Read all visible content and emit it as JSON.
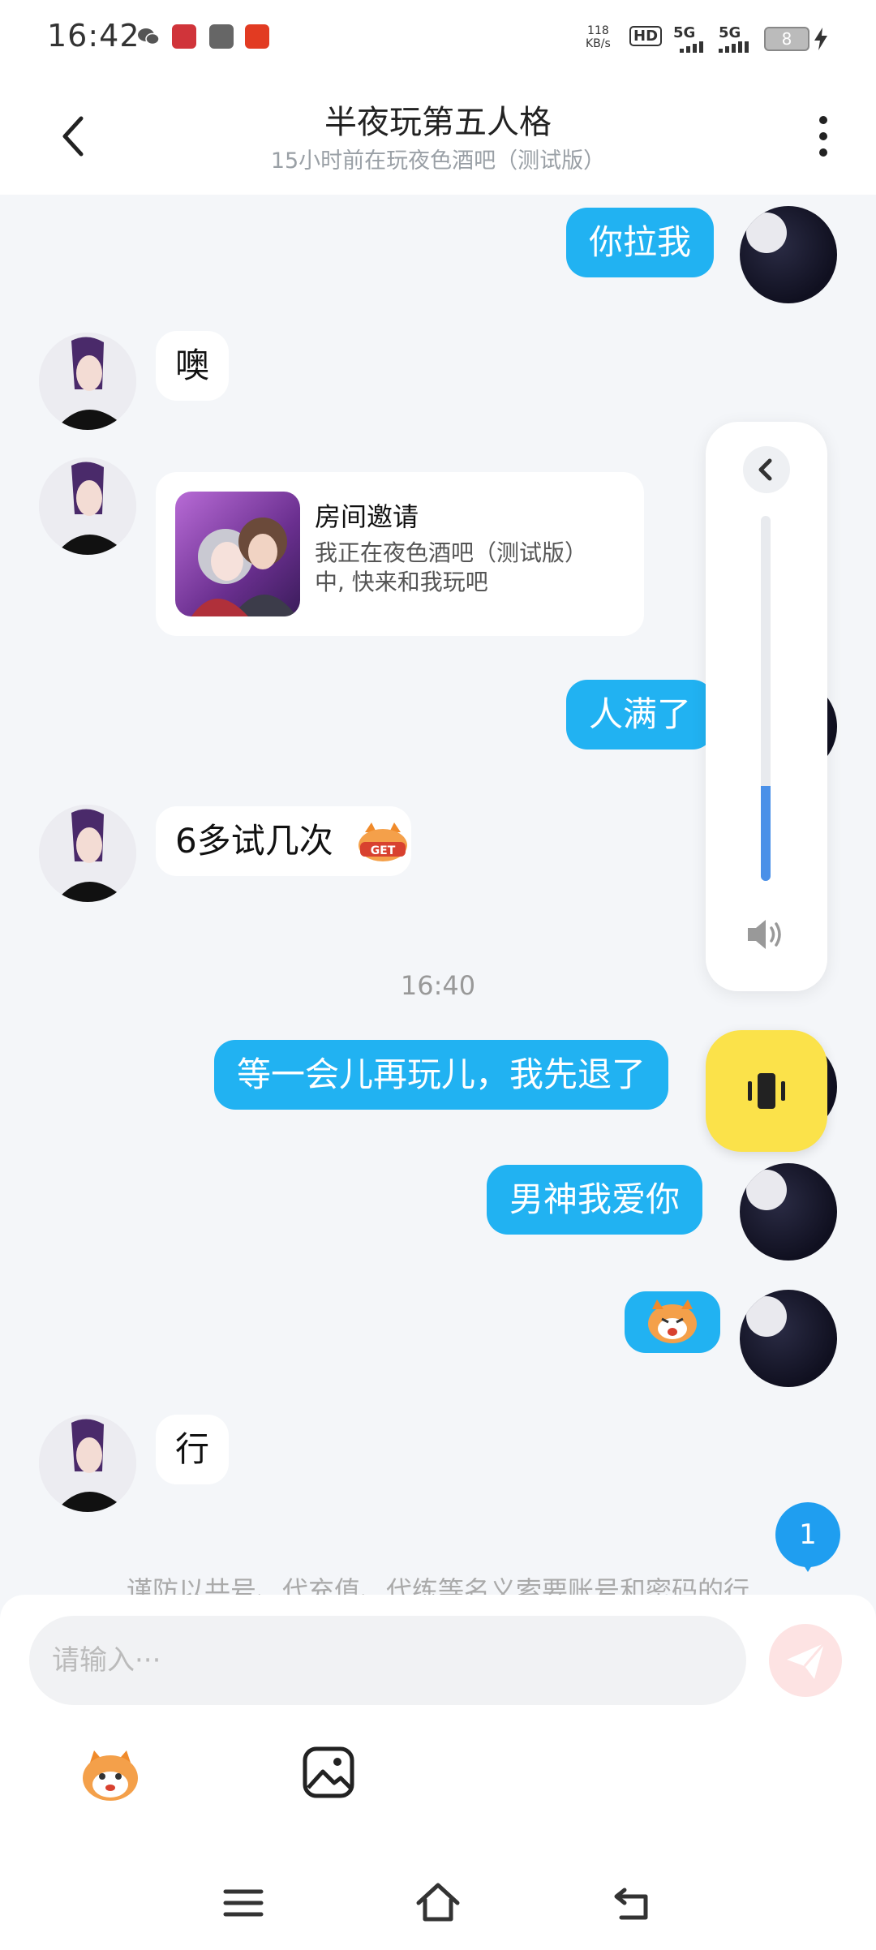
{
  "status_bar": {
    "time": "16:42",
    "net_speed_value": "118",
    "net_speed_unit": "KB/s",
    "hd_label": "HD",
    "sim1": "5G",
    "sim2": "5G",
    "battery": "8"
  },
  "header": {
    "title": "半夜玩第五人格",
    "subtitle": "15小时前在玩夜色酒吧（测试版）"
  },
  "messages": {
    "m1": "你拉我",
    "m2": "噢",
    "m4": "人满了",
    "m5": "6多试几次",
    "m6": "等一会儿再玩儿，我先退了",
    "m7": "男神我爱你",
    "m9": "行"
  },
  "invite_card": {
    "title": "房间邀请",
    "text": "我正在夜色酒吧（测试版）中, 快来和我玩吧"
  },
  "sticker_text": "GET",
  "timestamp": "16:40",
  "volume_panel": {
    "level": 0.26
  },
  "notice": "谨防以共号、代充值、代练等名义索要账号和密码的行",
  "unread_badge": "1",
  "input": {
    "placeholder": "请输入···"
  },
  "colors": {
    "my_bubble": "#21b2f2",
    "vibrate_button": "#fbe24a",
    "volume_fill": "#4a90e8"
  },
  "icons": [
    "back-icon",
    "more-icon",
    "collapse-icon",
    "speaker-icon",
    "vibrate-icon",
    "send-icon",
    "emoji-icon",
    "image-icon",
    "menu-icon",
    "home-icon",
    "back-nav-icon"
  ]
}
